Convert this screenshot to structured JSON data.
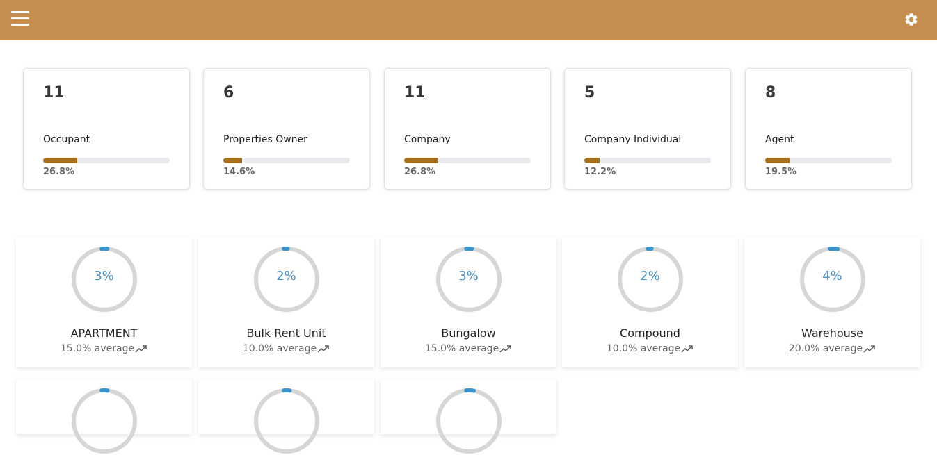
{
  "header": {
    "menu_icon": "hamburger-menu-icon",
    "settings_icon": "gear-icon",
    "bg_color": "#c48e4f"
  },
  "stats": [
    {
      "count": "11",
      "label": "Occupant",
      "percent_text": "26.8%",
      "percent": 26.8
    },
    {
      "count": "6",
      "label": "Properties Owner",
      "percent_text": "14.6%",
      "percent": 14.6
    },
    {
      "count": "11",
      "label": "Company",
      "percent_text": "26.8%",
      "percent": 26.8
    },
    {
      "count": "5",
      "label": "Company Individual",
      "percent_text": "12.2%",
      "percent": 12.2
    },
    {
      "count": "8",
      "label": "Agent",
      "percent_text": "19.5%",
      "percent": 19.5
    }
  ],
  "property_types": [
    {
      "percent_text": "3%",
      "percent": 3,
      "name": "APARTMENT",
      "average": "15.0% average"
    },
    {
      "percent_text": "2%",
      "percent": 2,
      "name": "Bulk Rent Unit",
      "average": "10.0% average"
    },
    {
      "percent_text": "3%",
      "percent": 3,
      "name": "Bungalow",
      "average": "15.0% average"
    },
    {
      "percent_text": "2%",
      "percent": 2,
      "name": "Compound",
      "average": "10.0% average"
    },
    {
      "percent_text": "4%",
      "percent": 4,
      "name": "Warehouse",
      "average": "20.0% average"
    },
    {
      "percent": 3
    },
    {
      "percent": 3
    },
    {
      "percent": 4
    }
  ],
  "colors": {
    "bar_fill": "#a57020",
    "ring_track": "#d6d6d6",
    "ring_fill": "#3a94cc",
    "ring_text": "#4a8fc2"
  }
}
